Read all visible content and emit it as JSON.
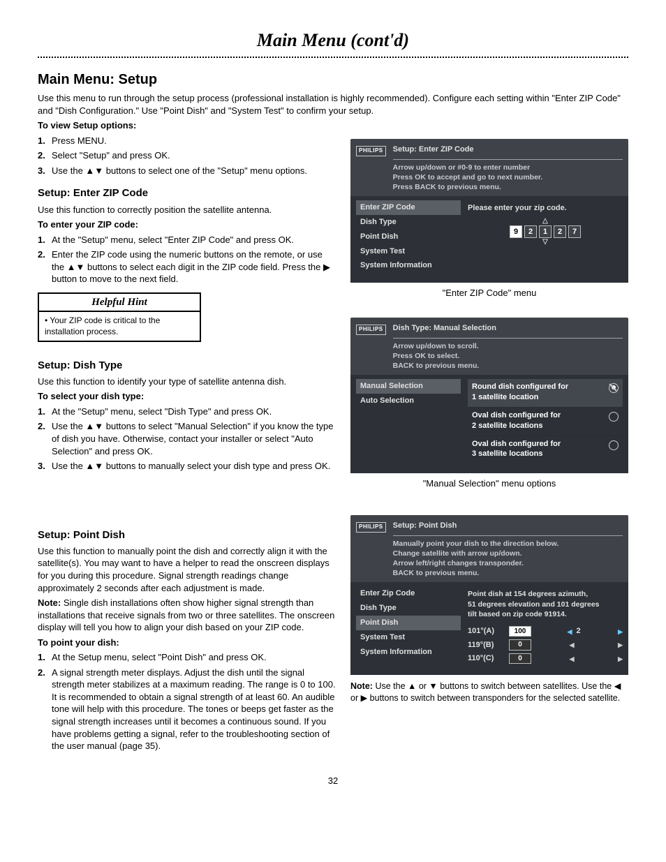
{
  "page_title": "Main Menu (cont'd)",
  "page_number": "32",
  "section1": {
    "heading": "Main Menu: Setup",
    "intro": "Use this menu to run through the setup process (professional installation is highly recommended). Configure each setting within \"Enter ZIP Code\" and \"Dish Configuration.\" Use \"Point Dish\" and \"System Test\" to confirm your setup.",
    "view_label": "To view Setup options:",
    "steps": {
      "s1": "Press MENU.",
      "s2": "Select \"Setup\" and press OK.",
      "s3": "Use the ▲▼ buttons to select one of the \"Setup\" menu options."
    }
  },
  "zip": {
    "heading": "Setup: Enter ZIP Code",
    "intro": "Use this function to correctly position the satellite antenna.",
    "enter_label": "To enter your ZIP code:",
    "steps": {
      "s1": "At the \"Setup\" menu, select \"Enter ZIP Code\" and press OK.",
      "s2": "Enter the ZIP code using the numeric buttons on the remote, or use the ▲▼ buttons to select each digit in the ZIP code field. Press the ▶ button to move to the next field."
    }
  },
  "hint": {
    "title": "Helpful Hint",
    "body": "Your ZIP code is critical to the installation process."
  },
  "dish": {
    "heading": "Setup: Dish Type",
    "intro": "Use this function to identify your type of satellite antenna dish.",
    "select_label": "To select your dish type:",
    "steps": {
      "s1": "At the \"Setup\" menu, select \"Dish Type\" and press OK.",
      "s2": "Use the ▲▼ buttons to select \"Manual Selection\" if you know the type of dish you have. Otherwise, contact your installer or select \"Auto Selection\" and press OK.",
      "s3": "Use the ▲▼ buttons to manually select your dish type and press OK."
    }
  },
  "point": {
    "heading": "Setup: Point Dish",
    "intro": "Use this function to manually point the dish and correctly align it with the satellite(s). You may want to have a helper to read the onscreen displays for you during this procedure. Signal strength readings change approximately 2 seconds after each adjustment is made.",
    "note_label": "Note:",
    "note_body": "Single dish installations often show higher signal strength than installations that receive signals from two or three satellites. The onscreen display will tell you how to align your dish based on your ZIP code.",
    "point_label": "To point your dish:",
    "steps": {
      "s1": "At the Setup menu, select \"Point Dish\" and press OK.",
      "s2": "A signal strength meter displays. Adjust the dish until the signal strength meter stabilizes at a maximum reading. The range is 0 to 100. It is recommended to obtain a signal strength of at least 60. An audible tone will help with this procedure. The tones or beeps get faster as the signal strength increases until it becomes a continuous sound. If you have problems getting a signal, refer to the troubleshooting section of the user manual (page 35)."
    }
  },
  "tv_zip": {
    "logo": "PHILIPS",
    "title": "Setup: Enter ZIP Code",
    "help1": "Arrow up/down or #0-9 to enter number",
    "help2": "Press OK to accept and go to next number.",
    "help3": "Press BACK to previous menu.",
    "menu": {
      "m1": "Enter ZIP Code",
      "m2": "Dish Type",
      "m3": "Point Dish",
      "m4": "System Test",
      "m5": "System Information"
    },
    "prompt": "Please enter your zip code.",
    "digits": {
      "d1": "9",
      "d2": "2",
      "d3": "1",
      "d4": "2",
      "d5": "7"
    },
    "caption": "\"Enter ZIP Code\" menu"
  },
  "tv_dish": {
    "logo": "PHILIPS",
    "title": "Dish Type: Manual Selection",
    "help1": "Arrow up/down to scroll.",
    "help2": "Press OK to select.",
    "help3": "BACK to previous menu.",
    "menu": {
      "m1": "Manual Selection",
      "m2": "Auto Selection"
    },
    "opt1a": "Round dish configured for",
    "opt1b": "1 satellite location",
    "opt2a": "Oval dish configured for",
    "opt2b": "2 satellite locations",
    "opt3a": "Oval dish configured for",
    "opt3b": "3 satellite locations",
    "caption": "\"Manual Selection\" menu options"
  },
  "tv_point": {
    "logo": "PHILIPS",
    "title": "Setup: Point Dish",
    "help1": "Manually point your dish to the direction below.",
    "help2": "Change satellite with arrow up/down.",
    "help3": "Arrow left/right changes transponder.",
    "help4": "BACK to previous menu.",
    "menu": {
      "m1": "Enter Zip Code",
      "m2": "Dish Type",
      "m3": "Point Dish",
      "m4": "System Test",
      "m5": "System Information"
    },
    "info1": "Point dish at 154 degrees azimuth,",
    "info2": "51 degrees elevation and 101 degrees",
    "info3": "tilt based on zip code 91914.",
    "rowA_lbl": "101°(A)",
    "rowA_val": "100",
    "rowA_tr": "2",
    "rowB_lbl": "119°(B)",
    "rowB_val": "0",
    "rowC_lbl": "110°(C)",
    "rowC_val": "0",
    "note_label": "Note:",
    "note_body": "Use the ▲ or ▼ buttons to switch between satellites. Use the ◀ or ▶ buttons to switch between transponders for the selected satellite."
  }
}
